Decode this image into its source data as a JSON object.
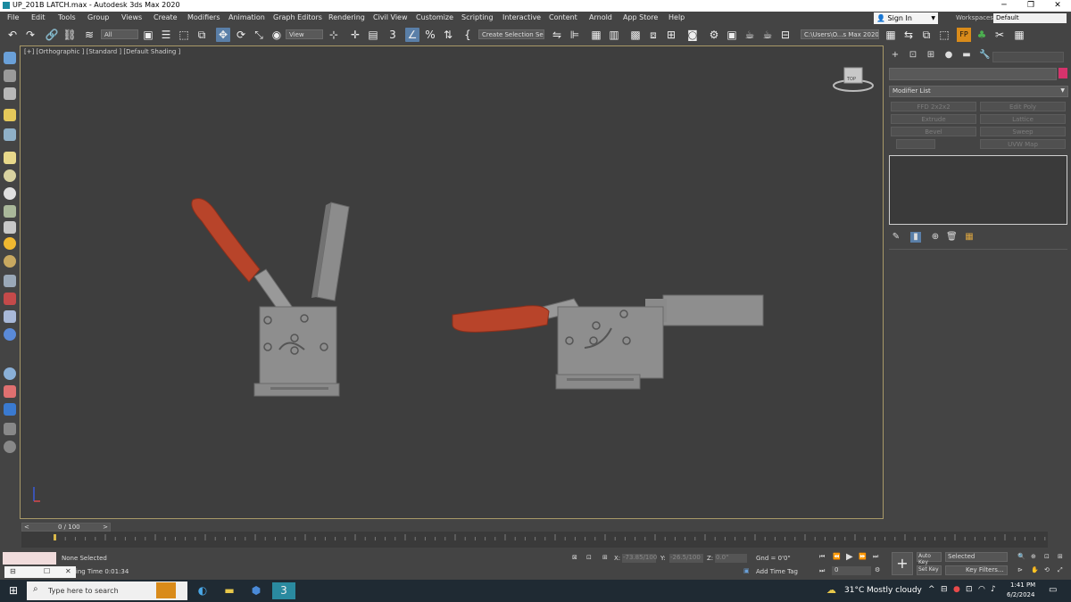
{
  "window": {
    "title": "UP_201B LATCH.max - Autodesk 3ds Max 2020",
    "minimize_glyph": "─",
    "restore_glyph": "❐",
    "close_glyph": "✕"
  },
  "menu": [
    "File",
    "Edit",
    "Tools",
    "Group",
    "Views",
    "Create",
    "Modifiers",
    "Animation",
    "Graph Editors",
    "Rendering",
    "Civil View",
    "Customize",
    "Scripting",
    "Interactive",
    "Content",
    "Arnold",
    "App Store",
    "Help"
  ],
  "account": {
    "sign_in": "Sign In",
    "workspaces_label": "Workspaces:",
    "workspace_value": "Default"
  },
  "toolbar": {
    "selection_filter": "All",
    "reference_coord": "View",
    "named_selection": "Create Selection Se",
    "project_path": "C:\\Users\\O...s Max 2020"
  },
  "viewport": {
    "label": "[+] [Orthographic ] [Standard ] [Default Shading ]",
    "viewcube_label": "TOP",
    "colors": {
      "body": "#8c8c8c",
      "handle": "#b8442a",
      "background": "#3e3e3e"
    }
  },
  "command_panel": {
    "modifier_list": "Modifier List",
    "modifier_buttons": [
      "FFD 2x2x2",
      "Edit Poly",
      "Extrude",
      "Lattice",
      "Bevel",
      "Sweep",
      "",
      "UVW Map"
    ],
    "name_field_placeholder": "",
    "color_swatch": "#d6336c"
  },
  "timeline": {
    "frame": "0 / 100",
    "prev": "<",
    "next": ">"
  },
  "status": {
    "selection": "None Selected",
    "rendering_time": "Rendering Time  0:01:34",
    "x_label": "X:",
    "x_value": "-73.85/100",
    "y_label": "Y:",
    "y_value": "-26.5/100",
    "z_label": "Z:",
    "z_value": "0.0\"",
    "grid": "Gnd = 0'0\"",
    "add_time_tag": "Add Time Tag",
    "auto_key": "Auto Key",
    "set_key": "Set Key",
    "key_mode": "Selected",
    "key_filters": "Key Filters...",
    "frame_field": "0"
  },
  "taskbar": {
    "search_placeholder": "Type here to search",
    "weather_temp": "31°C",
    "weather_desc": "Mostly cloudy",
    "time": "1:41 PM",
    "date": "6/2/2024"
  }
}
